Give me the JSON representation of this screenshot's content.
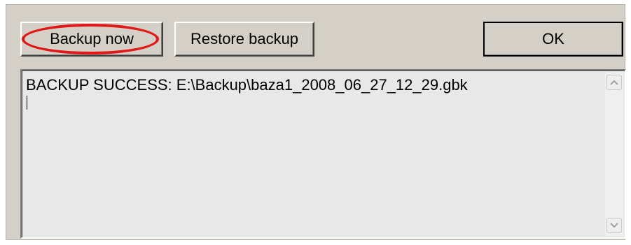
{
  "toolbar": {
    "backup_label": "Backup now",
    "restore_label": "Restore backup",
    "ok_label": "OK"
  },
  "log": {
    "text": "BACKUP SUCCESS: E:\\Backup\\baza1_2008_06_27_12_29.gbk"
  },
  "icons": {
    "scroll_up": "chevron-up-icon",
    "scroll_down": "chevron-down-icon"
  },
  "colors": {
    "panel_bg": "#d4d0c8",
    "highlight": "#e01818",
    "log_bg": "#e8e8e8"
  }
}
